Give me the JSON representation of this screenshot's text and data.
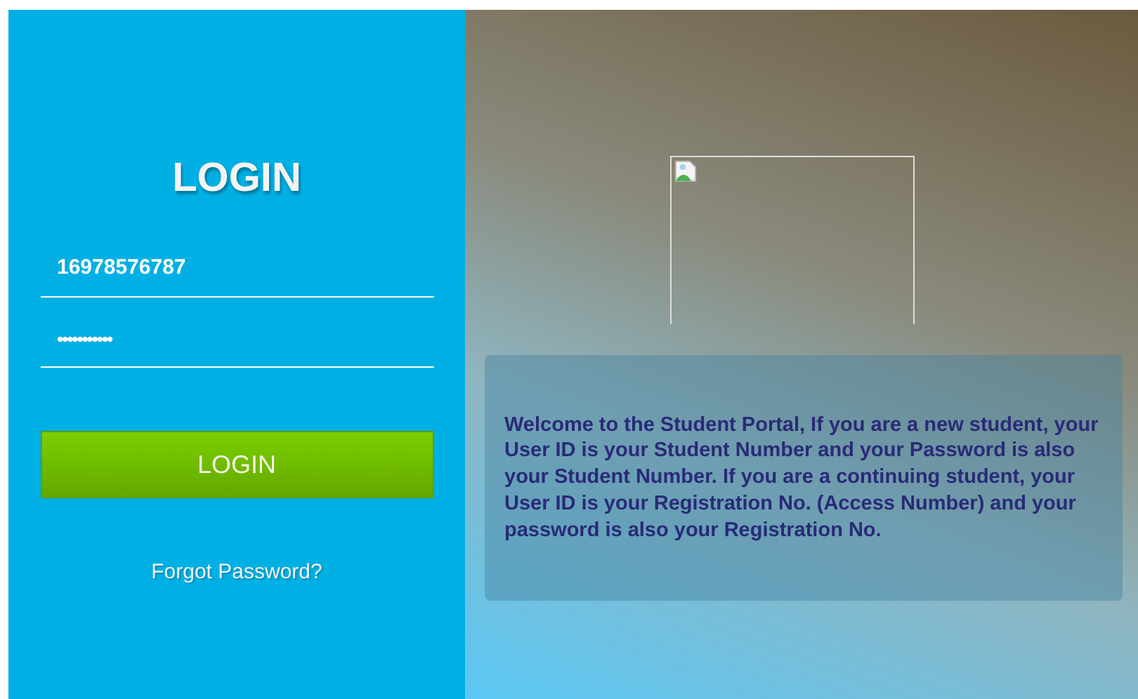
{
  "login_panel": {
    "title": "LOGIN",
    "user_id": {
      "value": "16978576787"
    },
    "password": {
      "value": "•••••••••••"
    },
    "login_button": "LOGIN",
    "forgot_link": "Forgot Password?"
  },
  "info_panel": {
    "image": {
      "kind": "broken-image"
    },
    "message": "Welcome to the Student Portal, If you are a new student, your User ID is your Student Number and your Password is also your Student Number. If you are a continuing student, your User ID is your Registration No. (Access Number) and your password is also your Registration No."
  }
}
